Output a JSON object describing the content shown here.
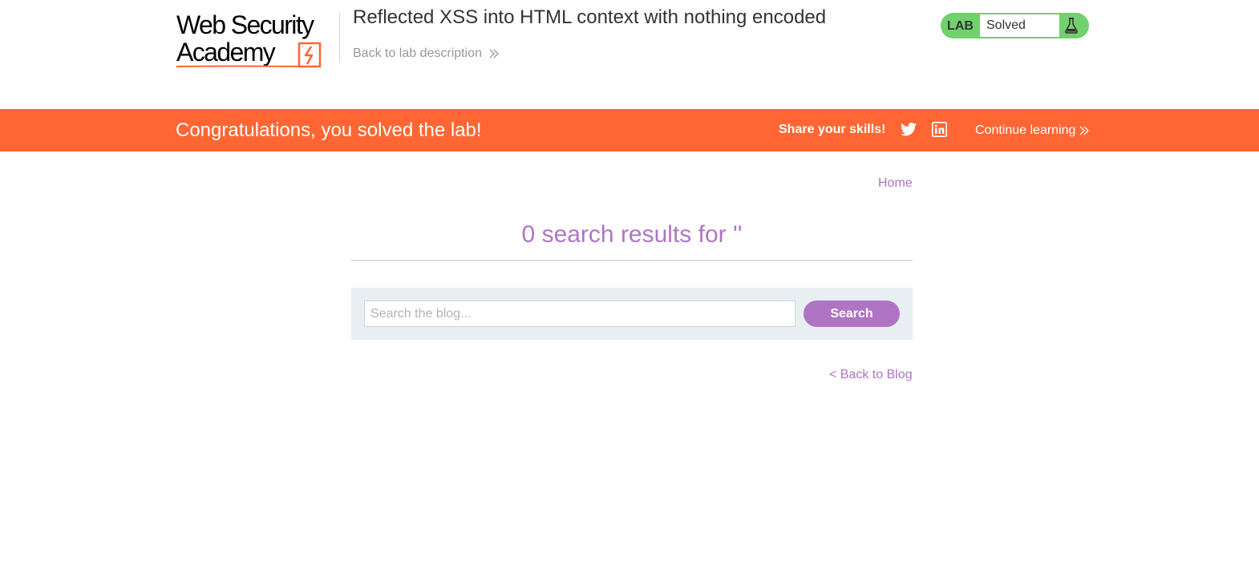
{
  "header": {
    "logo_line1": "Web Security",
    "logo_line2": "Academy",
    "lab_title": "Reflected XSS into HTML context with nothing encoded",
    "back_to_description": "Back to lab description",
    "status": {
      "tag": "LAB",
      "value": "Solved",
      "icon": "flask-icon"
    }
  },
  "banner": {
    "message": "Congratulations, you solved the lab!",
    "share_label": "Share your skills!",
    "share_icons": [
      "twitter-icon",
      "linkedin-icon"
    ],
    "continue_label": "Continue learning"
  },
  "main": {
    "home_link": "Home",
    "results_heading": "0 search results for ''",
    "search": {
      "placeholder": "Search the blog...",
      "value": "",
      "button_label": "Search"
    },
    "back_to_blog": "< Back to Blog"
  },
  "colors": {
    "banner": "#ff6633",
    "accent": "#b074c4",
    "status_green": "#70d16d",
    "search_panel": "#e8eef1"
  }
}
